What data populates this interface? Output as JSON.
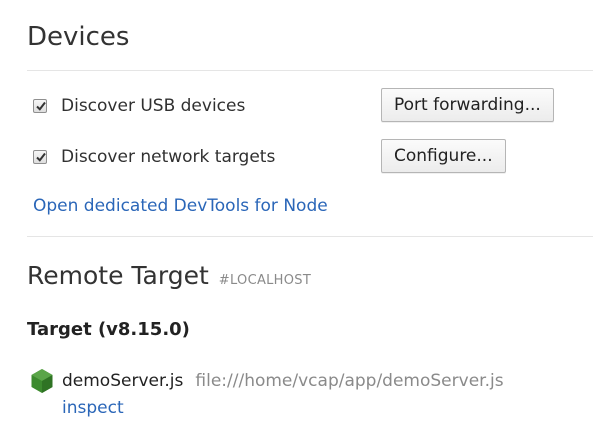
{
  "devices": {
    "title": "Devices",
    "options": [
      {
        "label": "Discover USB devices",
        "checked": true,
        "button_label": "Port forwarding..."
      },
      {
        "label": "Discover network targets",
        "checked": true,
        "button_label": "Configure..."
      }
    ],
    "node_link": "Open dedicated DevTools for Node"
  },
  "remote_target": {
    "title": "Remote Target",
    "subtitle": "#LOCALHOST",
    "target_heading": "Target (v8.15.0)",
    "targets": [
      {
        "icon": "nodejs-hexagon-icon",
        "icon_color": "#3c8a2e",
        "name": "demoServer.js",
        "url": "file:///home/vcap/app/demoServer.js",
        "action": "inspect"
      }
    ]
  },
  "colors": {
    "link": "#2a66b8",
    "muted": "#8a8a8a"
  }
}
